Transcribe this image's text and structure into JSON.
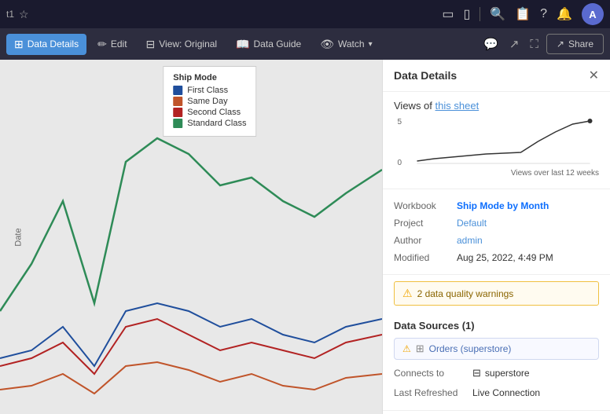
{
  "topNav": {
    "tabTitle": "t1",
    "starIcon": "★",
    "icons": [
      "□",
      "⬜",
      "|",
      "🔍",
      "📋",
      "?",
      "🔔"
    ],
    "avatarLabel": "A"
  },
  "toolbar": {
    "dataDetailsLabel": "Data Details",
    "editLabel": "Edit",
    "viewOriginalLabel": "View: Original",
    "dataGuideLabel": "Data Guide",
    "watchLabel": "Watch",
    "shareLabel": "Share",
    "dataDetailsIcon": "⊞",
    "editIcon": "✏",
    "viewIcon": "⊟",
    "dataGuideIcon": "📖",
    "watchIcon": "👁"
  },
  "legend": {
    "title": "Ship Mode",
    "items": [
      {
        "label": "First Class",
        "color": "#1f4e9c"
      },
      {
        "label": "Same Day",
        "color": "#c0542a"
      },
      {
        "label": "Second Class",
        "color": "#b22222"
      },
      {
        "label": "Standard Class",
        "color": "#2e8b57"
      }
    ]
  },
  "chartAxis": {
    "yLabel": "Date"
  },
  "panel": {
    "title": "Data Details",
    "closeIcon": "✕",
    "viewsTitle": "Views of",
    "viewsThisSheet": "this sheet",
    "sparklineMax": "5",
    "sparklineMin": "0",
    "viewsOverLabel": "Views over last 12 weeks",
    "workbookLabel": "Workbook",
    "workbookValue": "Ship Mode by Month",
    "projectLabel": "Project",
    "projectValue": "Default",
    "authorLabel": "Author",
    "authorValue": "admin",
    "modifiedLabel": "Modified",
    "modifiedValue": "Aug 25, 2022, 4:49 PM",
    "warningText": "2 data quality warnings",
    "warningIcon": "⚠",
    "dataSourcesTitle": "Data Sources (1)",
    "dataSourceName": "Orders (superstore)",
    "dataSourceWarningIcon": "⚠",
    "connectsToLabel": "Connects to",
    "connectsToIcon": "⊞",
    "connectsToValue": "superstore",
    "lastRefreshedLabel": "Last Refreshed",
    "lastRefreshedValue": "Live Connection"
  }
}
